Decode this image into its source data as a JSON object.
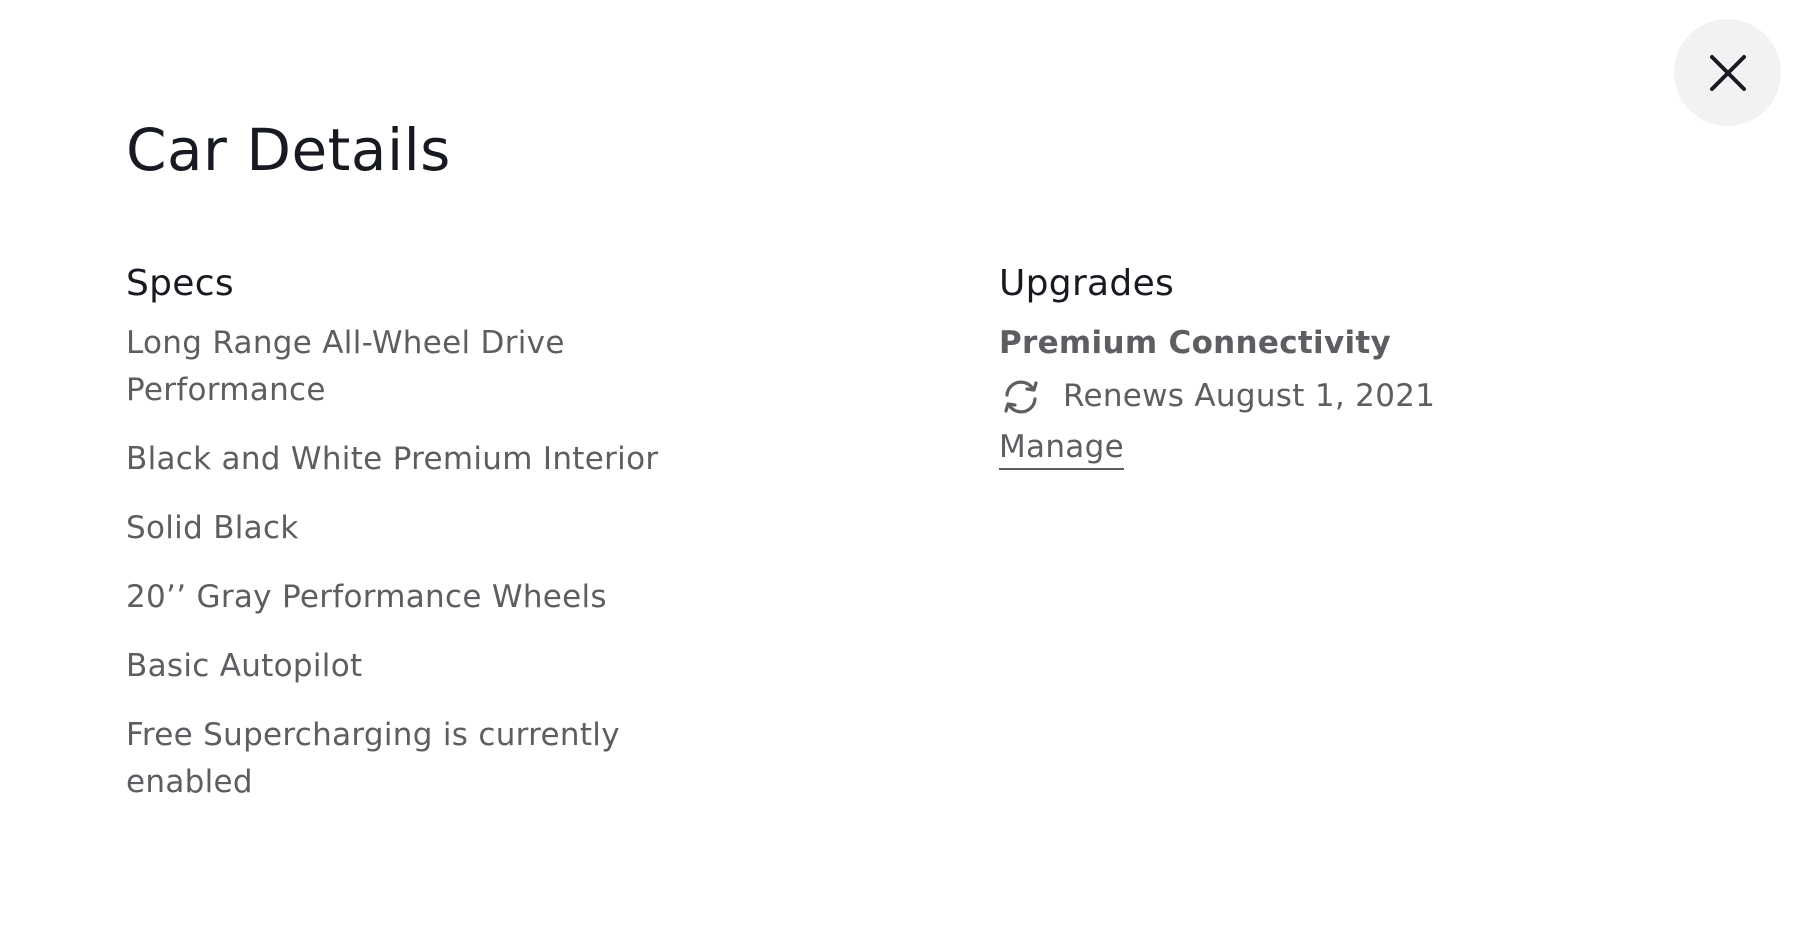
{
  "modal": {
    "title": "Car Details",
    "close_icon": "close-icon"
  },
  "specs": {
    "heading": "Specs",
    "items": [
      "Long Range All-Wheel Drive Performance",
      "Black and White Premium Interior",
      "Solid Black",
      "20’’ Gray Performance Wheels",
      "Basic Autopilot",
      "Free Supercharging is currently enabled"
    ]
  },
  "upgrades": {
    "heading": "Upgrades",
    "items": [
      {
        "name": "Premium Connectivity",
        "renew_icon": "refresh-icon",
        "renew_text": "Renews August 1, 2021",
        "manage_label": "Manage"
      }
    ]
  },
  "colors": {
    "heading": "#171a20",
    "body_text": "#5c5e62",
    "close_button_bg": "#f2f2f2",
    "background": "#ffffff"
  }
}
